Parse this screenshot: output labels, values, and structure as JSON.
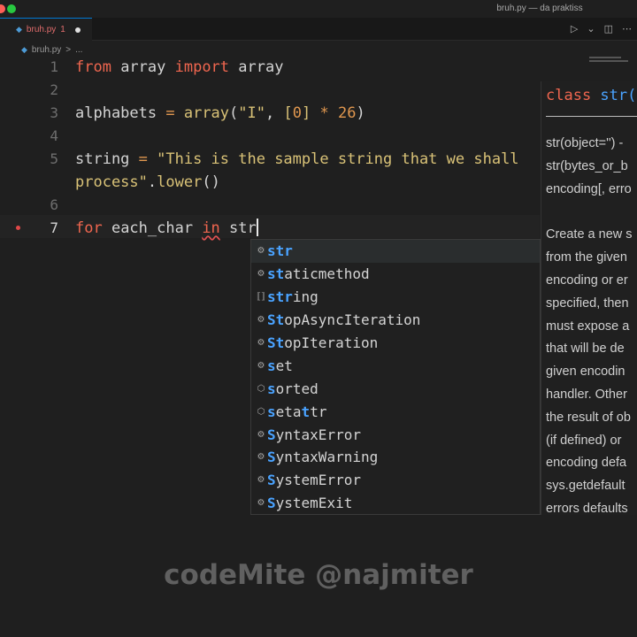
{
  "window": {
    "title": "bruh.py — da praktiss"
  },
  "tab": {
    "icon": "python-file-icon",
    "name": "bruh.py",
    "problems": "1",
    "modified": true
  },
  "toolbar": {
    "run_icon": "▷",
    "run_menu_icon": "⌄",
    "split_icon": "◫",
    "more_icon": "⋯"
  },
  "breadcrumb": {
    "file": "bruh.py",
    "sep": ">",
    "tail": "..."
  },
  "editor": {
    "lines": [
      {
        "number": "1"
      },
      {
        "number": "2"
      },
      {
        "number": "3"
      },
      {
        "number": "4"
      },
      {
        "number": "5"
      },
      {
        "number": ""
      },
      {
        "number": "6"
      },
      {
        "number": "7"
      }
    ],
    "code": {
      "l1_from": "from",
      "l1_mod": " array ",
      "l1_import": "import",
      "l1_name": " array",
      "l3_var": "alphabets ",
      "l3_eq": "=",
      "l3_fn": " array",
      "l3_p1": "(",
      "l3_str": "\"I\"",
      "l3_comma": ", ",
      "l3_lb": "[",
      "l3_num0": "0",
      "l3_rb": "]",
      "l3_mul": " * ",
      "l3_num26": "26",
      "l3_p2": ")",
      "l5_var": "string ",
      "l5_eq": "=",
      "l5_str1": " \"This is the sample string that we shall",
      "l5b_str2": "process\"",
      "l5b_dot": ".",
      "l5b_fn": "lower",
      "l5b_paren": "()",
      "l7_for": "for",
      "l7_var": " each_char ",
      "l7_in": "in",
      "l7_typed": " str"
    }
  },
  "suggestions": [
    {
      "icon": "class-icon",
      "glyph": "⚙",
      "match": "str",
      "rest": "",
      "selected": true
    },
    {
      "icon": "class-icon",
      "glyph": "⚙",
      "match": "st",
      "rest": "aticmethod",
      "selected": false
    },
    {
      "icon": "variable-icon",
      "glyph": "⟦⟧",
      "match": "str",
      "rest": "ing",
      "selected": false
    },
    {
      "icon": "class-icon",
      "glyph": "⚙",
      "match": "St",
      "rest": "opAsyncIteration",
      "selected": false
    },
    {
      "icon": "class-icon",
      "glyph": "⚙",
      "match": "St",
      "rest": "opIteration",
      "selected": false
    },
    {
      "icon": "class-icon",
      "glyph": "⚙",
      "match": "s",
      "rest": "et",
      "selected": false
    },
    {
      "icon": "function-icon",
      "glyph": "⬡",
      "match": "s",
      "rest": "orted",
      "selected": false,
      "match2": "",
      "rest2": ""
    },
    {
      "icon": "function-icon",
      "glyph": "⬡",
      "match": "s",
      "rest": "eta",
      "match2": "t",
      "rest2": "tr",
      "selected": false
    },
    {
      "icon": "class-icon",
      "glyph": "⚙",
      "match": "S",
      "rest": "ynta",
      "match2": "",
      "rest2": "xError",
      "selected": false
    },
    {
      "icon": "class-icon",
      "glyph": "⚙",
      "match": "S",
      "rest": "yntaxWarning",
      "selected": false
    },
    {
      "icon": "class-icon",
      "glyph": "⚙",
      "match": "S",
      "rest": "ystemError",
      "selected": false
    },
    {
      "icon": "class-icon",
      "glyph": "⚙",
      "match": "S",
      "rest": "ystemExit",
      "selected": false
    }
  ],
  "docs": {
    "signature_kw": "class ",
    "signature_name": "str(",
    "lines": [
      "str(object='') -",
      "str(bytes_or_b",
      "encoding[, erro",
      "",
      "Create a new s",
      "from the given",
      "encoding or er",
      "specified, then",
      "must expose a",
      "that will be de",
      "given encodin",
      "handler. Other",
      "the result of ob",
      "(if defined) or",
      "encoding defa",
      "sys.getdefault",
      "errors defaults"
    ]
  },
  "watermark": "codeMite @najmiter",
  "colors": {
    "accent": "#0078d4",
    "keyword": "#f0664f",
    "match": "#4aa3ff",
    "string": "#d9c277",
    "number": "#e0974f"
  }
}
